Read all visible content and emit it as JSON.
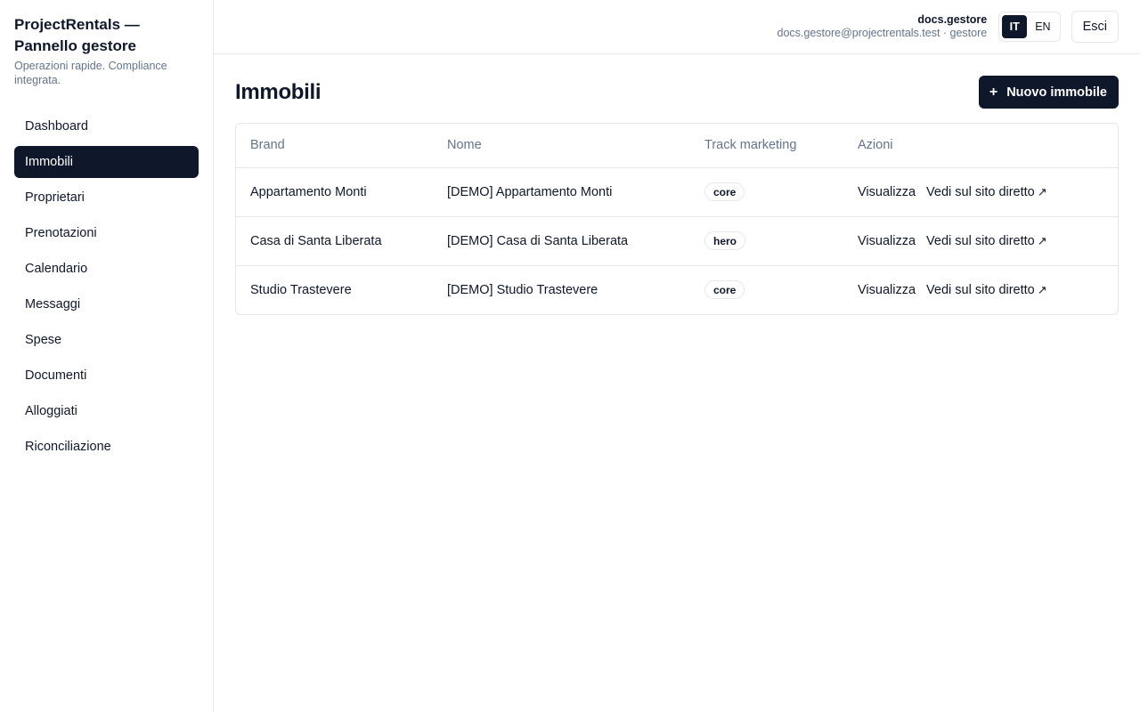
{
  "sidebar": {
    "title": "ProjectRentals — Pannello gestore",
    "subtitle": "Operazioni rapide. Compliance integrata.",
    "items": [
      {
        "label": "Dashboard"
      },
      {
        "label": "Immobili",
        "active": true
      },
      {
        "label": "Proprietari"
      },
      {
        "label": "Prenotazioni"
      },
      {
        "label": "Calendario"
      },
      {
        "label": "Messaggi"
      },
      {
        "label": "Spese"
      },
      {
        "label": "Documenti"
      },
      {
        "label": "Alloggiati"
      },
      {
        "label": "Riconciliazione"
      }
    ]
  },
  "header": {
    "user_name": "docs.gestore",
    "user_email": "docs.gestore@projectrentals.test · gestore",
    "lang": {
      "it": "IT",
      "en": "EN",
      "active": "IT"
    },
    "logout_label": "Esci"
  },
  "main": {
    "title": "Immobili",
    "new_button": {
      "icon": "+",
      "label": "Nuovo immobile"
    },
    "table": {
      "columns": [
        "Brand",
        "Nome",
        "Track marketing",
        "Azioni"
      ],
      "rows": [
        {
          "brand": "Appartamento Monti",
          "nome": "[DEMO] Appartamento Monti",
          "track": "core"
        },
        {
          "brand": "Casa di Santa Liberata",
          "nome": "[DEMO] Casa di Santa Liberata",
          "track": "hero"
        },
        {
          "brand": "Studio Trastevere",
          "nome": "[DEMO] Studio Trastevere",
          "track": "core"
        }
      ],
      "actions": {
        "view": "Visualizza",
        "site": "Vedi sul sito diretto",
        "site_icon": "↗"
      }
    }
  },
  "colors": {
    "primary": "#0f172a",
    "muted": "#64748b",
    "border": "#e5e7eb"
  }
}
